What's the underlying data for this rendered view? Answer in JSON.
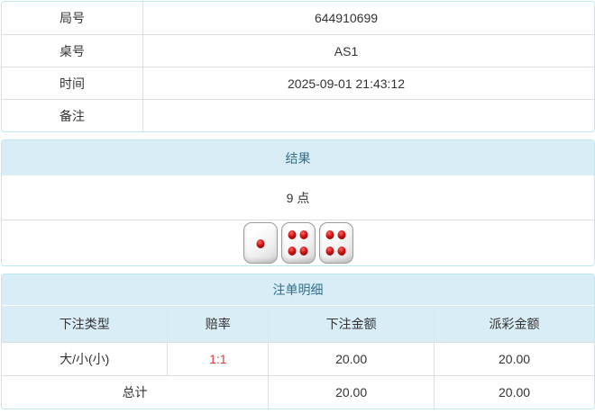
{
  "info_table": {
    "rows": [
      {
        "label": "局号",
        "value": "644910699"
      },
      {
        "label": "桌号",
        "value": "AS1"
      },
      {
        "label": "时间",
        "value": "2025-09-01 21:43:12"
      },
      {
        "label": "备注",
        "value": ""
      }
    ]
  },
  "result_panel": {
    "title": "结果",
    "points": "9 点",
    "dice": [
      1,
      4,
      4
    ]
  },
  "bets_panel": {
    "title": "注单明细",
    "columns": [
      "下注类型",
      "赔率",
      "下注金额",
      "派彩金额"
    ],
    "rows": [
      {
        "bet_type": "大/小(小)",
        "odds": "1:1",
        "bet_amount": "20.00",
        "payout_amount": "20.00"
      }
    ],
    "total": {
      "label": "总计",
      "bet_amount": "20.00",
      "payout_amount": "20.00"
    }
  },
  "colors": {
    "panel_border": "#bce8f1",
    "heading_background": "#d9edf7",
    "heading_text": "#31708f",
    "row_divider": "#dddddd",
    "odds_text": "#e4393c",
    "body_text": "#333333",
    "dice_pip": "#cc1111"
  }
}
